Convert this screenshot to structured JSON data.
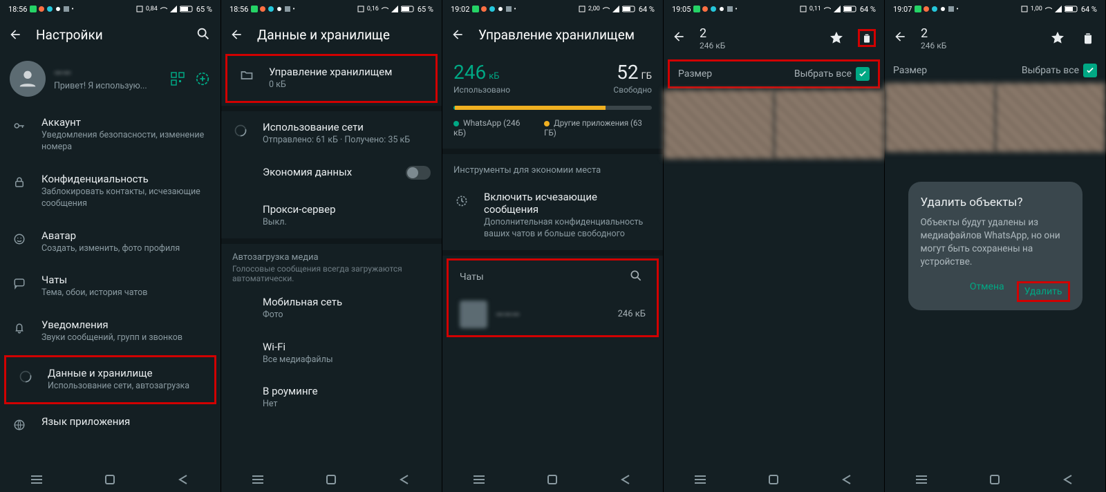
{
  "status": {
    "a": {
      "time": "18:56",
      "battery": "65 %",
      "net": "0,84"
    },
    "b": {
      "time": "18:56",
      "battery": "65 %",
      "net": "0,16"
    },
    "c": {
      "time": "19:02",
      "battery": "64 %",
      "net": "2,00"
    },
    "d": {
      "time": "19:05",
      "battery": "64 %",
      "net": "0,11"
    },
    "e": {
      "time": "19:07",
      "battery": "64 %",
      "net": "1,00"
    }
  },
  "p1": {
    "title": "Настройки",
    "profile_name": "——",
    "profile_status": "Привет! Я использую...",
    "items": {
      "account": {
        "label": "Аккаунт",
        "sub": "Уведомления безопасности, изменение номера"
      },
      "privacy": {
        "label": "Конфиденциальность",
        "sub": "Заблокировать контакты, исчезающие сообщения"
      },
      "avatar": {
        "label": "Аватар",
        "sub": "Создать, изменить, фото профиля"
      },
      "chats": {
        "label": "Чаты",
        "sub": "Тема, обои, история чатов"
      },
      "notif": {
        "label": "Уведомления",
        "sub": "Звуки сообщений, групп и звонков"
      },
      "data": {
        "label": "Данные и хранилище",
        "sub": "Использование сети, автозагрузка"
      },
      "lang": {
        "label": "Язык приложения"
      }
    }
  },
  "p2": {
    "title": "Данные и хранилище",
    "storage": {
      "label": "Управление хранилищем",
      "sub": "0 кБ"
    },
    "network": {
      "label": "Использование сети",
      "sub": "Отправлено: 61 кБ · Получено: 35 кБ"
    },
    "saver": {
      "label": "Экономия данных"
    },
    "proxy": {
      "label": "Прокси-сервер",
      "sub": "Выкл."
    },
    "section_auto_title": "Автозагрузка медиа",
    "section_auto_sub": "Голосовые сообщения всегда загружаются автоматически.",
    "mobile": {
      "label": "Мобильная сеть",
      "sub": "Фото"
    },
    "wifi": {
      "label": "Wi-Fi",
      "sub": "Все медиафайлы"
    },
    "roaming": {
      "label": "В роуминге",
      "sub": "Нет"
    }
  },
  "p3": {
    "title": "Управление хранилищем",
    "used_value": "246",
    "used_unit": "кБ",
    "used_label": "Использовано",
    "free_value": "52",
    "free_unit": "ГБ",
    "free_label": "Свободно",
    "legend_wa": "WhatsApp (246 кБ)",
    "legend_other": "Другие приложения (63 ГБ)",
    "tools_header": "Инструменты для экономии места",
    "disappearing": {
      "label": "Включить исчезающие сообщения",
      "sub": "Дополнительная конфиденциальность ваших чатов и больше свободного"
    },
    "chats_header": "Чаты",
    "chat_row": {
      "name": "———",
      "size": "246 кБ"
    }
  },
  "p4": {
    "count": "2",
    "size": "246 кБ",
    "subhead_left": "Размер",
    "select_all": "Выбрать все"
  },
  "p5": {
    "count": "2",
    "size": "246 кБ",
    "subhead_left": "Размер",
    "select_all": "Выбрать все",
    "dialog": {
      "title": "Удалить объекты?",
      "text": "Объекты будут удалены из медиафайлов WhatsApp, но они могут быть сохранены на устройстве.",
      "cancel": "Отмена",
      "delete": "Удалить"
    }
  }
}
